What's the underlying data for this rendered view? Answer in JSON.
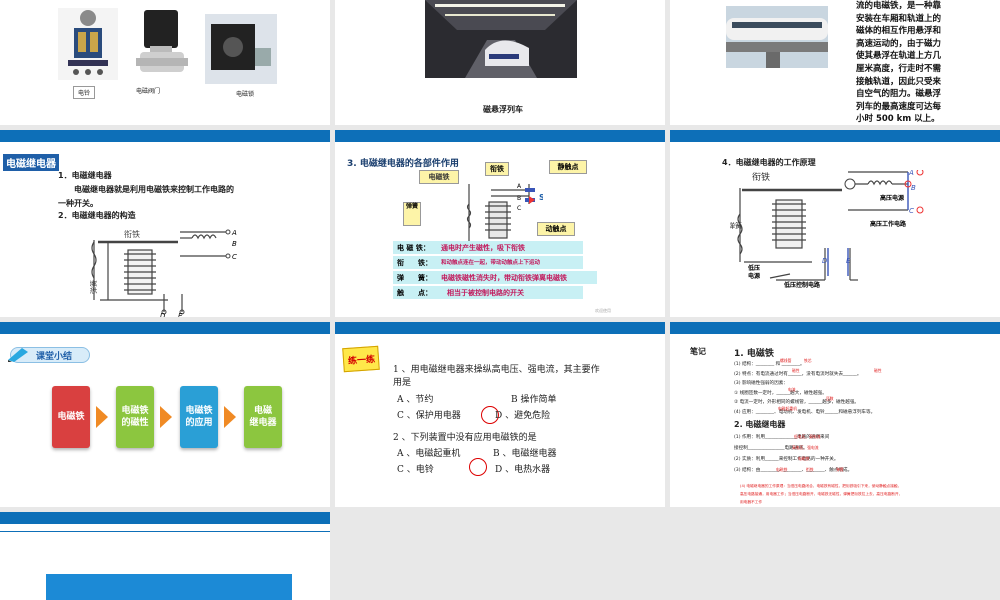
{
  "s1": {
    "captions": [
      "电铃",
      "电磁阀门",
      "电磁锁"
    ]
  },
  "s2": {
    "caption": "磁悬浮列车"
  },
  "s3": {
    "text_lines": [
      "流的电磁铁，是一种靠",
      "安装在车厢和轨道上的",
      "磁体的相互作用悬浮和",
      "高速运动的，由于磁力",
      "使其悬浮在轨道上方几",
      "厘米高度，行走时不需",
      "接触轨道，因此只受来",
      "自空气的阻力。磁悬浮",
      "列车的最高速度可达每",
      "小时 500 km 以上。"
    ]
  },
  "s4": {
    "tag": "电磁继电器",
    "line1": "1．电磁继电器",
    "line2": "电磁继电器就是利用电磁铁来控制工作电路的",
    "line3": "一种开关。",
    "line4": "2．电磁继电器的构造",
    "diagram": {
      "armature": "衔铁",
      "spring": "弹簧",
      "magnet": "电磁铁",
      "A": "A",
      "B": "B",
      "C": "C",
      "D": "D",
      "E": "E"
    }
  },
  "s5": {
    "title": "3. 电磁继电器的各部件作用",
    "labels": {
      "magnet": "电磁铁",
      "armature": "衔铁",
      "static": "静触点",
      "spring": "弹簧",
      "moving": "动触点",
      "A": "A",
      "B": "B",
      "C": "C",
      "S": "S"
    },
    "rows": [
      {
        "k": "电 磁 铁：",
        "v": "通电时产生磁性，吸下衔铁"
      },
      {
        "k": "衔　　铁：",
        "v": "和动触点连在一起，带动动触点上下运动"
      },
      {
        "k": "弹　　簧：",
        "v": "电磁铁磁性消失时，带动衔铁弹离电磁铁"
      },
      {
        "k": "触　　点：",
        "v": "相当于被控制电路的开关"
      }
    ],
    "watermark": "欢迎使用"
  },
  "s6": {
    "title": "4．电磁继电器的工作原理",
    "labels": {
      "armature": "衔铁",
      "spring": "弹簧",
      "magnet": "电磁铁",
      "hv_power": "高压电源",
      "hv_circuit": "高压工作电路",
      "lv_power_1": "低压",
      "lv_power_2": "电源",
      "lv_circuit": "低压控制电路",
      "A": "A",
      "B": "B",
      "C": "C",
      "D": "D",
      "E": "E"
    }
  },
  "s7": {
    "title": "课堂小结",
    "steps": [
      "电磁铁",
      "电磁铁\n的磁性",
      "电磁铁\n的应用",
      "电磁\n继电器"
    ],
    "colors": [
      "#d94040",
      "#8cc63f",
      "#2a9fd6",
      "#8cc63f"
    ]
  },
  "s8": {
    "badge": "练一练",
    "q1": "1 、用电磁继电器来操纵高电压、强电流，其主要作",
    "q1b": "用是",
    "q1_opts": [
      "A 、节约",
      "B 操作简单",
      "C 、保护用电器",
      "D 、避免危险"
    ],
    "q2": "2 、下列装置中没有应用电磁铁的是",
    "q2_opts": [
      "A 、电磁起重机",
      "B 、电磁继电器",
      "C 、电铃",
      "D 、电热水器"
    ]
  },
  "s9": {
    "label": "笔记",
    "h1": "1. 电磁铁",
    "lines": [
      "(1) 结构：________ 和 ________。",
      "(2) 特点：有电流通过时有______，没有电流时就失去______。",
      "(3) 影响磁性强弱的因素：",
      "① 线圈匝数一定时，______越大，磁性越强。",
      "② 电流一定时，外形相同的螺线管，______越多，磁性越强。",
      "(4) 应用：________、电动机、发电机、电铃______和磁悬浮列车等。"
    ],
    "h2": "2. 电磁继电器",
    "lines2": [
      "(1) 作用：利用______________电路的通断来间",
      "接控制________________电路通断。",
      "(2) 实质：利用______来控制工作电路的一种开关。",
      "(3) 结构：由________、________、________、触点组成。"
    ],
    "red_fills": [
      "螺线管",
      "铁芯",
      "磁性",
      "磁性",
      "电流",
      "匝数",
      "电磁起重机",
      "低电压、弱电流",
      "高电压、强电流",
      "电磁铁",
      "电磁铁",
      "衔铁",
      "弹簧"
    ],
    "red_note": [
      "(4) 电磁继电器的工作原理：当低压电路闭合，电磁铁有磁性，把衔铁吸引下来，使动静触点接触，",
      "高压电路接通，用电器工作；当低压电路断开，电磁铁无磁性，弹簧把衔铁拉上去，高压电路断开，",
      "用电器不工作"
    ]
  }
}
